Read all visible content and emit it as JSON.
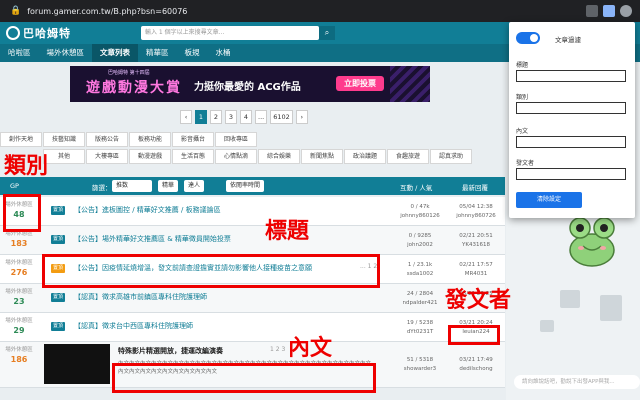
{
  "browser": {
    "url": "forum.gamer.com.tw/B.php?bsn=60076"
  },
  "header": {
    "logo": "巴哈姆特",
    "search_placeholder": "輸入 1 個字以上來搜尋文章..."
  },
  "nav": [
    "哈啦區",
    "場外休憩區",
    "文章列表",
    "精華區",
    "板規",
    "水桶"
  ],
  "banner": {
    "sub": "巴哈姆特 第十四屆",
    "big": "遊戲動漫大賞",
    "slogan": "力挺你最愛的 ACG作品",
    "vote": "立即投票"
  },
  "pager": [
    "1",
    "2",
    "3",
    "4",
    "...",
    "6102"
  ],
  "categories": [
    [
      "創作天地",
      "技藝知識",
      "版務公告",
      "板務功能",
      "影音攝台",
      "回收專區"
    ],
    [
      "類別",
      "其他",
      "大樓專區",
      "動漫遊戲",
      "生活百態",
      "心情點滴",
      "綜合娛樂",
      "新聞焦點",
      "政治議題",
      "食趣旅遊",
      "認真求助"
    ]
  ],
  "list_head": {
    "gp": "GP",
    "filter": "篩選：",
    "sort": "推数",
    "cols": [
      "精華",
      "達人",
      "依閱率時間"
    ],
    "interact": "互動 / 人氣",
    "last_reply": "最新回覆"
  },
  "rows": [
    {
      "gp_label": "場外休憩區",
      "gp": "48",
      "tag": "置頂",
      "tag_color": "blue",
      "title": "【公告】進板圖控 / 精華好文推薦 / 板務議論區",
      "stat": "0 / 47k",
      "stat2": "johnny860126",
      "last": "05/04 12:38",
      "last2": "johnny860726",
      "pages": ""
    },
    {
      "gp_label": "場外休憩區",
      "gp": "183",
      "tag": "置頂",
      "tag_color": "blue",
      "title": "【公告】場外精華好文推薦區 & 精華徵員開始投票",
      "stat": "0 / 9285",
      "stat2": "john2002",
      "last": "02/21 20:51",
      "last2": "YK431618",
      "pages": ""
    },
    {
      "gp_label": "場外休憩區",
      "gp": "276",
      "tag": "置頂",
      "tag_color": "orange",
      "title": "【公告】因疫情延燒增溫，發文前請查證擔實並請勿影響他人接種疫苗之意願",
      "stat": "1 / 23.1k",
      "stat2": "ssda1002",
      "last": "02/21 17:57",
      "last2": "MR4031",
      "pages": "... 1 2"
    },
    {
      "gp_label": "場外休憩區",
      "gp": "23",
      "tag": "置頂",
      "tag_color": "blue",
      "title": "【認真】徵求高雄市前鎮區專科住院護理師",
      "stat": "24 / 2804",
      "stat2": "ndpalder421",
      "last": "03/21 20:25",
      "last2": "",
      "pages": ""
    },
    {
      "gp_label": "場外休憩區",
      "gp": "29",
      "tag": "置頂",
      "tag_color": "blue",
      "title": "【認真】徵求台中西區專科住院護理師",
      "stat": "19 / 5238",
      "stat2": "dYt0231T",
      "last": "03/21 20:24",
      "last2": "leuian224",
      "pages": ""
    },
    {
      "gp_label": "場外休憩區",
      "gp": "186",
      "tag": "",
      "tag_color": "",
      "title": "特殊影片精選開放，捷運改編演奏",
      "stat": "51 / 5318",
      "stat2": "showarder3",
      "last": "03/21 17:49",
      "last2": "dedilschong",
      "pages": "1 2 3",
      "body": "內文內文內文內文內文內文內文內文內文內文內文內文內文內文內文內文內文內文內文內文內文內文內文內文內文內文內文內文內文內文內文內文"
    }
  ],
  "popup": {
    "toggle_label": "文章過濾",
    "fields": [
      "標題",
      "類別",
      "內文",
      "發文者"
    ],
    "clear": "清除設定"
  },
  "chat_placeholder": "請向誰說話吧，勸說下出發APP與我...",
  "annotations": {
    "category": "類別",
    "title": "標題",
    "body": "內文",
    "author": "發文者"
  }
}
